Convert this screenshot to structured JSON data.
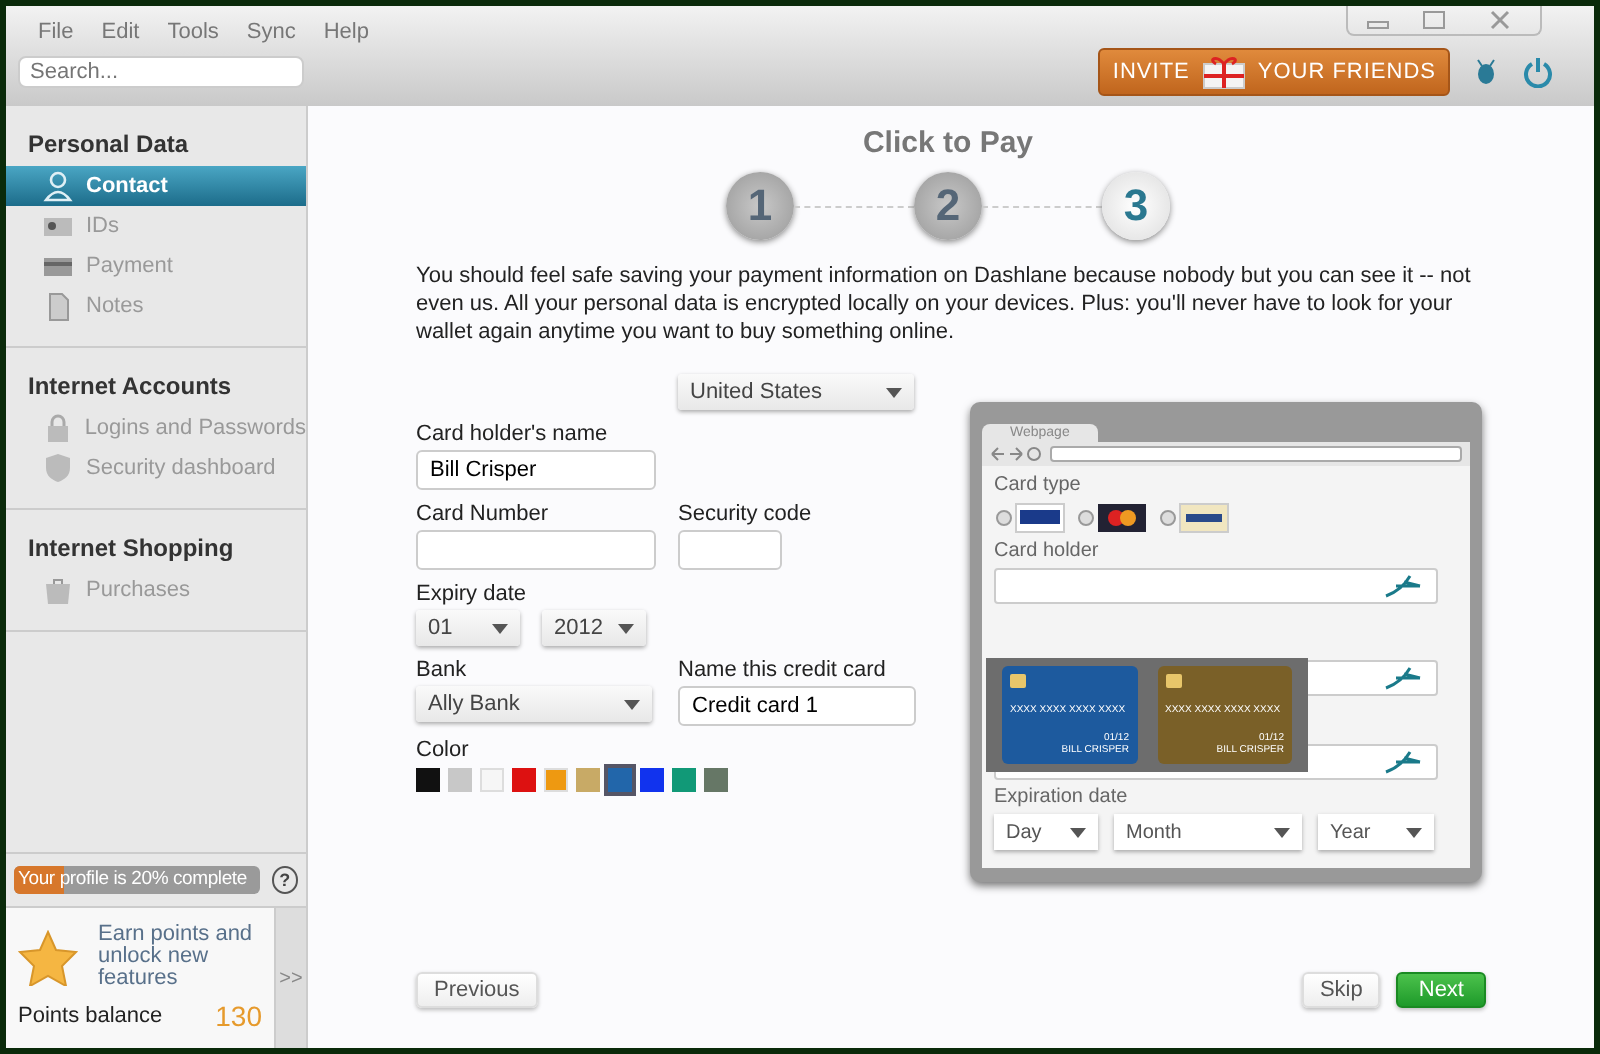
{
  "menu": [
    "File",
    "Edit",
    "Tools",
    "Sync",
    "Help"
  ],
  "search": {
    "placeholder": "Search..."
  },
  "invite": {
    "left": "INVITE",
    "right": "YOUR FRIENDS"
  },
  "sidebar": {
    "sections": [
      {
        "title": "Personal Data",
        "items": [
          {
            "label": "Contact",
            "kind": "person",
            "selected": true
          },
          {
            "label": "IDs",
            "kind": "id",
            "selected": false
          },
          {
            "label": "Payment",
            "kind": "card",
            "selected": false
          },
          {
            "label": "Notes",
            "kind": "note",
            "selected": false
          }
        ]
      },
      {
        "title": "Internet Accounts",
        "items": [
          {
            "label": "Logins and Passwords",
            "kind": "lock",
            "selected": false
          },
          {
            "label": "Security dashboard",
            "kind": "shield",
            "selected": false
          }
        ]
      },
      {
        "title": "Internet Shopping",
        "items": [
          {
            "label": "Purchases",
            "kind": "bag",
            "selected": false
          }
        ]
      }
    ]
  },
  "profile": {
    "text": "Your profile is 20% complete",
    "level": 0.2,
    "help": "?"
  },
  "points": {
    "promo": "Earn points and unlock new features",
    "label": "Points balance",
    "value": "130",
    "expand": ">>"
  },
  "page": {
    "title": "Click to Pay",
    "steps": [
      {
        "label": "1",
        "selected": false
      },
      {
        "label": "2",
        "selected": false
      },
      {
        "label": "3",
        "selected": true
      }
    ],
    "intro": "You should feel safe saving your payment information on Dashlane because nobody but you can see it -- not even us. All your personal data is encrypted locally on your devices. Plus: you'll never have to look for your wallet again anytime you want to buy something online."
  },
  "form": {
    "country": "United States",
    "holder": {
      "label": "Card holder's name",
      "value": "Bill Crisper"
    },
    "number": {
      "label": "Card Number"
    },
    "security": {
      "label": "Security code"
    },
    "expiry": {
      "label": "Expiry date",
      "month": "01",
      "year": "2012"
    },
    "bank": {
      "label": "Bank",
      "value": "Ally Bank"
    },
    "name": {
      "label": "Name this credit card",
      "value": "Credit card 1"
    },
    "color_label": "Color",
    "colors": [
      {
        "color": "#111111",
        "selected": false
      },
      {
        "color": "#c8c8c8",
        "selected": false
      },
      {
        "color": "#f6f6f6",
        "selected": false
      },
      {
        "color": "#dd1111",
        "selected": false
      },
      {
        "color": "#ee9911",
        "selected": false
      },
      {
        "color": "#c8aa66",
        "selected": false
      },
      {
        "color": "#2266aa",
        "selected": true
      },
      {
        "color": "#1133ee",
        "selected": false
      },
      {
        "color": "#119977",
        "selected": false
      },
      {
        "color": "#667766",
        "selected": false
      }
    ]
  },
  "illustration": {
    "tab": "Webpage",
    "card_type": "Card type",
    "card_holder": "Card holder",
    "expiration": "Expiration date",
    "selects": [
      "Day",
      "Month",
      "Year"
    ],
    "cards": [
      {
        "number": "XXXX XXXX XXXX XXXX",
        "expiry": "01/12",
        "name": "BILL CRISPER",
        "color": "#1d5a9e"
      },
      {
        "number": "XXXX XXXX XXXX XXXX",
        "expiry": "01/12",
        "name": "BILL CRISPER",
        "color": "#7a6028"
      }
    ]
  },
  "buttons": {
    "previous": "Previous",
    "skip": "Skip",
    "next": "Next"
  }
}
